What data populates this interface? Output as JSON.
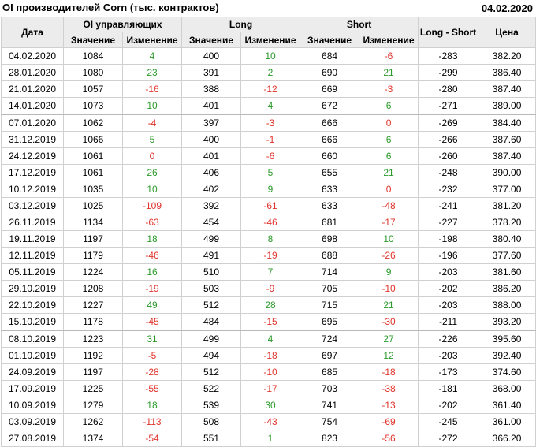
{
  "header": {
    "title": "OI производителей Corn (тыс. контрактов)",
    "date": "04.02.2020"
  },
  "columns": {
    "date": "Дата",
    "oi_managed": "OI управляющих",
    "long": "Long",
    "short": "Short",
    "long_short": "Long - Short",
    "price": "Цена",
    "value": "Значение",
    "change": "Изменение"
  },
  "colors": {
    "positive": "#2a9a2a",
    "negative": "#e0342c",
    "header_bg": "#ececec"
  },
  "rows": [
    {
      "date": "04.02.2020",
      "oi": "1084",
      "oi_chg": "4",
      "long": "400",
      "long_chg": "10",
      "short": "684",
      "short_chg": "-6",
      "ls": "-283",
      "price": "382.20"
    },
    {
      "date": "28.01.2020",
      "oi": "1080",
      "oi_chg": "23",
      "long": "391",
      "long_chg": "2",
      "short": "690",
      "short_chg": "21",
      "ls": "-299",
      "price": "386.40"
    },
    {
      "date": "21.01.2020",
      "oi": "1057",
      "oi_chg": "-16",
      "long": "388",
      "long_chg": "-12",
      "short": "669",
      "short_chg": "-3",
      "ls": "-280",
      "price": "387.40"
    },
    {
      "date": "14.01.2020",
      "oi": "1073",
      "oi_chg": "10",
      "long": "401",
      "long_chg": "4",
      "short": "672",
      "short_chg": "6",
      "ls": "-271",
      "price": "389.00"
    },
    {
      "date": "07.01.2020",
      "oi": "1062",
      "oi_chg": "-4",
      "long": "397",
      "long_chg": "-3",
      "short": "666",
      "short_chg": "0",
      "ls": "-269",
      "price": "384.40",
      "sep": true
    },
    {
      "date": "31.12.2019",
      "oi": "1066",
      "oi_chg": "5",
      "long": "400",
      "long_chg": "-1",
      "short": "666",
      "short_chg": "6",
      "ls": "-266",
      "price": "387.60"
    },
    {
      "date": "24.12.2019",
      "oi": "1061",
      "oi_chg": "0",
      "long": "401",
      "long_chg": "-6",
      "short": "660",
      "short_chg": "6",
      "ls": "-260",
      "price": "387.40"
    },
    {
      "date": "17.12.2019",
      "oi": "1061",
      "oi_chg": "26",
      "long": "406",
      "long_chg": "5",
      "short": "655",
      "short_chg": "21",
      "ls": "-248",
      "price": "390.00"
    },
    {
      "date": "10.12.2019",
      "oi": "1035",
      "oi_chg": "10",
      "long": "402",
      "long_chg": "9",
      "short": "633",
      "short_chg": "0",
      "ls": "-232",
      "price": "377.00"
    },
    {
      "date": "03.12.2019",
      "oi": "1025",
      "oi_chg": "-109",
      "long": "392",
      "long_chg": "-61",
      "short": "633",
      "short_chg": "-48",
      "ls": "-241",
      "price": "381.20"
    },
    {
      "date": "26.11.2019",
      "oi": "1134",
      "oi_chg": "-63",
      "long": "454",
      "long_chg": "-46",
      "short": "681",
      "short_chg": "-17",
      "ls": "-227",
      "price": "378.20"
    },
    {
      "date": "19.11.2019",
      "oi": "1197",
      "oi_chg": "18",
      "long": "499",
      "long_chg": "8",
      "short": "698",
      "short_chg": "10",
      "ls": "-198",
      "price": "380.40"
    },
    {
      "date": "12.11.2019",
      "oi": "1179",
      "oi_chg": "-46",
      "long": "491",
      "long_chg": "-19",
      "short": "688",
      "short_chg": "-26",
      "ls": "-196",
      "price": "377.60"
    },
    {
      "date": "05.11.2019",
      "oi": "1224",
      "oi_chg": "16",
      "long": "510",
      "long_chg": "7",
      "short": "714",
      "short_chg": "9",
      "ls": "-203",
      "price": "381.60"
    },
    {
      "date": "29.10.2019",
      "oi": "1208",
      "oi_chg": "-19",
      "long": "503",
      "long_chg": "-9",
      "short": "705",
      "short_chg": "-10",
      "ls": "-202",
      "price": "386.20"
    },
    {
      "date": "22.10.2019",
      "oi": "1227",
      "oi_chg": "49",
      "long": "512",
      "long_chg": "28",
      "short": "715",
      "short_chg": "21",
      "ls": "-203",
      "price": "388.00"
    },
    {
      "date": "15.10.2019",
      "oi": "1178",
      "oi_chg": "-45",
      "long": "484",
      "long_chg": "-15",
      "short": "695",
      "short_chg": "-30",
      "ls": "-211",
      "price": "393.20"
    },
    {
      "date": "08.10.2019",
      "oi": "1223",
      "oi_chg": "31",
      "long": "499",
      "long_chg": "4",
      "short": "724",
      "short_chg": "27",
      "ls": "-226",
      "price": "395.60",
      "sep": true
    },
    {
      "date": "01.10.2019",
      "oi": "1192",
      "oi_chg": "-5",
      "long": "494",
      "long_chg": "-18",
      "short": "697",
      "short_chg": "12",
      "ls": "-203",
      "price": "392.40"
    },
    {
      "date": "24.09.2019",
      "oi": "1197",
      "oi_chg": "-28",
      "long": "512",
      "long_chg": "-10",
      "short": "685",
      "short_chg": "-18",
      "ls": "-173",
      "price": "374.60"
    },
    {
      "date": "17.09.2019",
      "oi": "1225",
      "oi_chg": "-55",
      "long": "522",
      "long_chg": "-17",
      "short": "703",
      "short_chg": "-38",
      "ls": "-181",
      "price": "368.00"
    },
    {
      "date": "10.09.2019",
      "oi": "1279",
      "oi_chg": "18",
      "long": "539",
      "long_chg": "30",
      "short": "741",
      "short_chg": "-13",
      "ls": "-202",
      "price": "361.40"
    },
    {
      "date": "03.09.2019",
      "oi": "1262",
      "oi_chg": "-113",
      "long": "508",
      "long_chg": "-43",
      "short": "754",
      "short_chg": "-69",
      "ls": "-245",
      "price": "361.00"
    },
    {
      "date": "27.08.2019",
      "oi": "1374",
      "oi_chg": "-54",
      "long": "551",
      "long_chg": "1",
      "short": "823",
      "short_chg": "-56",
      "ls": "-272",
      "price": "366.20"
    }
  ]
}
